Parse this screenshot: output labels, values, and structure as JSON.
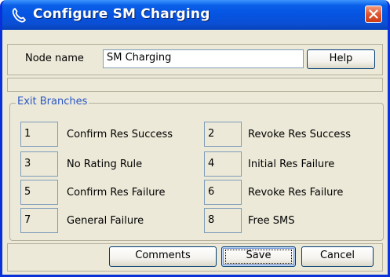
{
  "window": {
    "title": "Configure SM Charging",
    "colors": {
      "titlebar": "#0554e3",
      "face": "#ece9d8",
      "close": "#e0562f",
      "legend": "#2a57c6"
    }
  },
  "header": {
    "node_name_label": "Node name",
    "node_name_value": "SM Charging",
    "help_label": "Help"
  },
  "exit_branches": {
    "legend": "Exit Branches",
    "items": [
      {
        "number": "1",
        "label": "Confirm Res Success"
      },
      {
        "number": "2",
        "label": "Revoke Res Success"
      },
      {
        "number": "3",
        "label": "No Rating Rule"
      },
      {
        "number": "4",
        "label": "Initial Res Failure"
      },
      {
        "number": "5",
        "label": "Confirm Res Failure"
      },
      {
        "number": "6",
        "label": "Revoke Res Failure"
      },
      {
        "number": "7",
        "label": "General Failure"
      },
      {
        "number": "8",
        "label": "Free SMS"
      }
    ]
  },
  "footer": {
    "comments_label": "Comments",
    "save_label": "Save",
    "cancel_label": "Cancel"
  }
}
